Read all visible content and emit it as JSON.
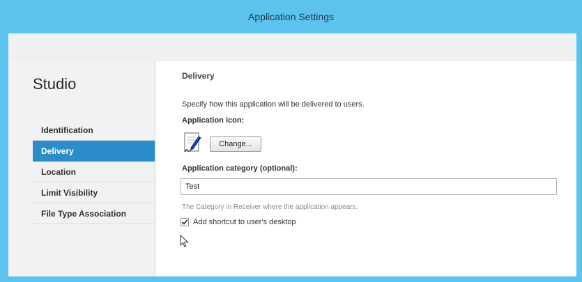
{
  "window": {
    "title": "Application Settings"
  },
  "sidebar": {
    "title": "Studio",
    "items": [
      {
        "label": "Identification",
        "active": false
      },
      {
        "label": "Delivery",
        "active": true
      },
      {
        "label": "Location",
        "active": false
      },
      {
        "label": "Limit Visibility",
        "active": false
      },
      {
        "label": "File Type Association",
        "active": false
      }
    ]
  },
  "delivery": {
    "section_title": "Delivery",
    "description": "Specify how this application will be delivered to users.",
    "icon_label": "Application icon:",
    "icon_name": "notepad-pen-icon",
    "change_button": "Change...",
    "category_label": "Application category (optional):",
    "category_value": "Test",
    "category_hint": "The Category in Receiver where the application appears.",
    "shortcut_label": "Add shortcut to user's desktop",
    "shortcut_checked": true
  },
  "colors": {
    "titlebar": "#5bc3ee",
    "active_nav": "#2b8ccc"
  }
}
